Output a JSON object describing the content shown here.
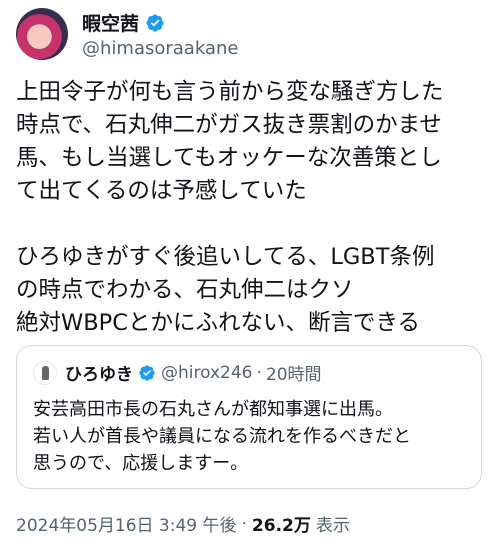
{
  "author": {
    "display_name": "暇空茜",
    "handle": "@himasoraakane",
    "verified_icon": "verified-badge-icon"
  },
  "tweet": {
    "lines": [
      "上田令子が何も言う前から変な騒ぎ方した",
      "時点で、石丸伸二がガス抜き票割のかませ",
      "馬、もし当選してもオッケーな次善策とし",
      "て出てくるのは予感していた",
      "ひろゆきがすぐ後追いしてる、LGBT条例",
      "の時点でわかる、石丸伸二はクソ",
      "絶対WBPCとかにふれない、断言できる"
    ]
  },
  "quote": {
    "display_name": "ひろゆき",
    "handle": "@hirox246",
    "separator": "·",
    "time": "20時間",
    "lines": [
      "安芸高田市長の石丸さんが都知事選に出馬。",
      "若い人が首長や議員になる流れを作るべきだと",
      "思うので、応援しますー。"
    ]
  },
  "meta": {
    "timestamp": "2024年05月16日 3:49 午後",
    "separator": "·",
    "views_count": "26.2万",
    "views_label": "表示"
  },
  "colors": {
    "verified": "#1d9bf0",
    "secondary_text": "#536471",
    "border": "#cfd9de"
  }
}
